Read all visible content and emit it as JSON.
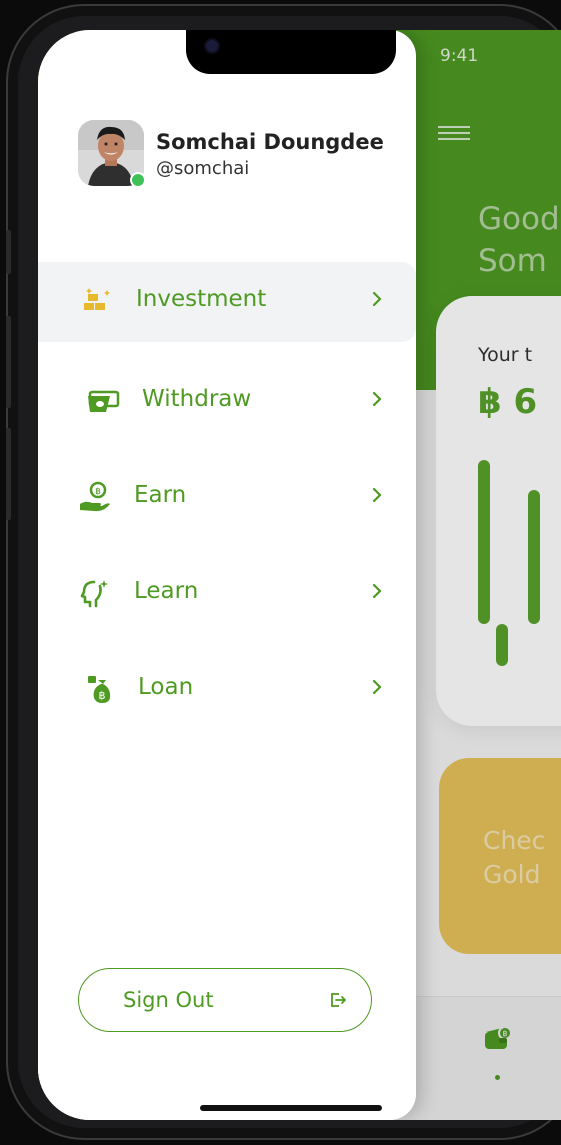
{
  "status_bar": {
    "time": "9:41"
  },
  "app": {
    "greeting_line1": "Good",
    "greeting_line2": "Som",
    "card_label": "Your t",
    "card_amount": "฿ 6",
    "promo_line1": "Chec",
    "promo_line2": "Gold"
  },
  "profile": {
    "name": "Somchai Doungdee",
    "handle": "@somchai",
    "online": true
  },
  "menu": {
    "items": [
      {
        "label": "Investment",
        "icon": "gold-bars-icon",
        "active": true
      },
      {
        "label": "Withdraw",
        "icon": "cash-icon",
        "active": false
      },
      {
        "label": "Earn",
        "icon": "coin-hand-icon",
        "active": false
      },
      {
        "label": "Learn",
        "icon": "head-idea-icon",
        "active": false
      },
      {
        "label": "Loan",
        "icon": "money-bag-icon",
        "active": false
      }
    ]
  },
  "sign_out": {
    "label": "Sign Out",
    "icon": "logout-icon"
  },
  "colors": {
    "primary": "#4e9a23",
    "gold": "#e7c25c",
    "active_bg": "#f2f3f5"
  }
}
